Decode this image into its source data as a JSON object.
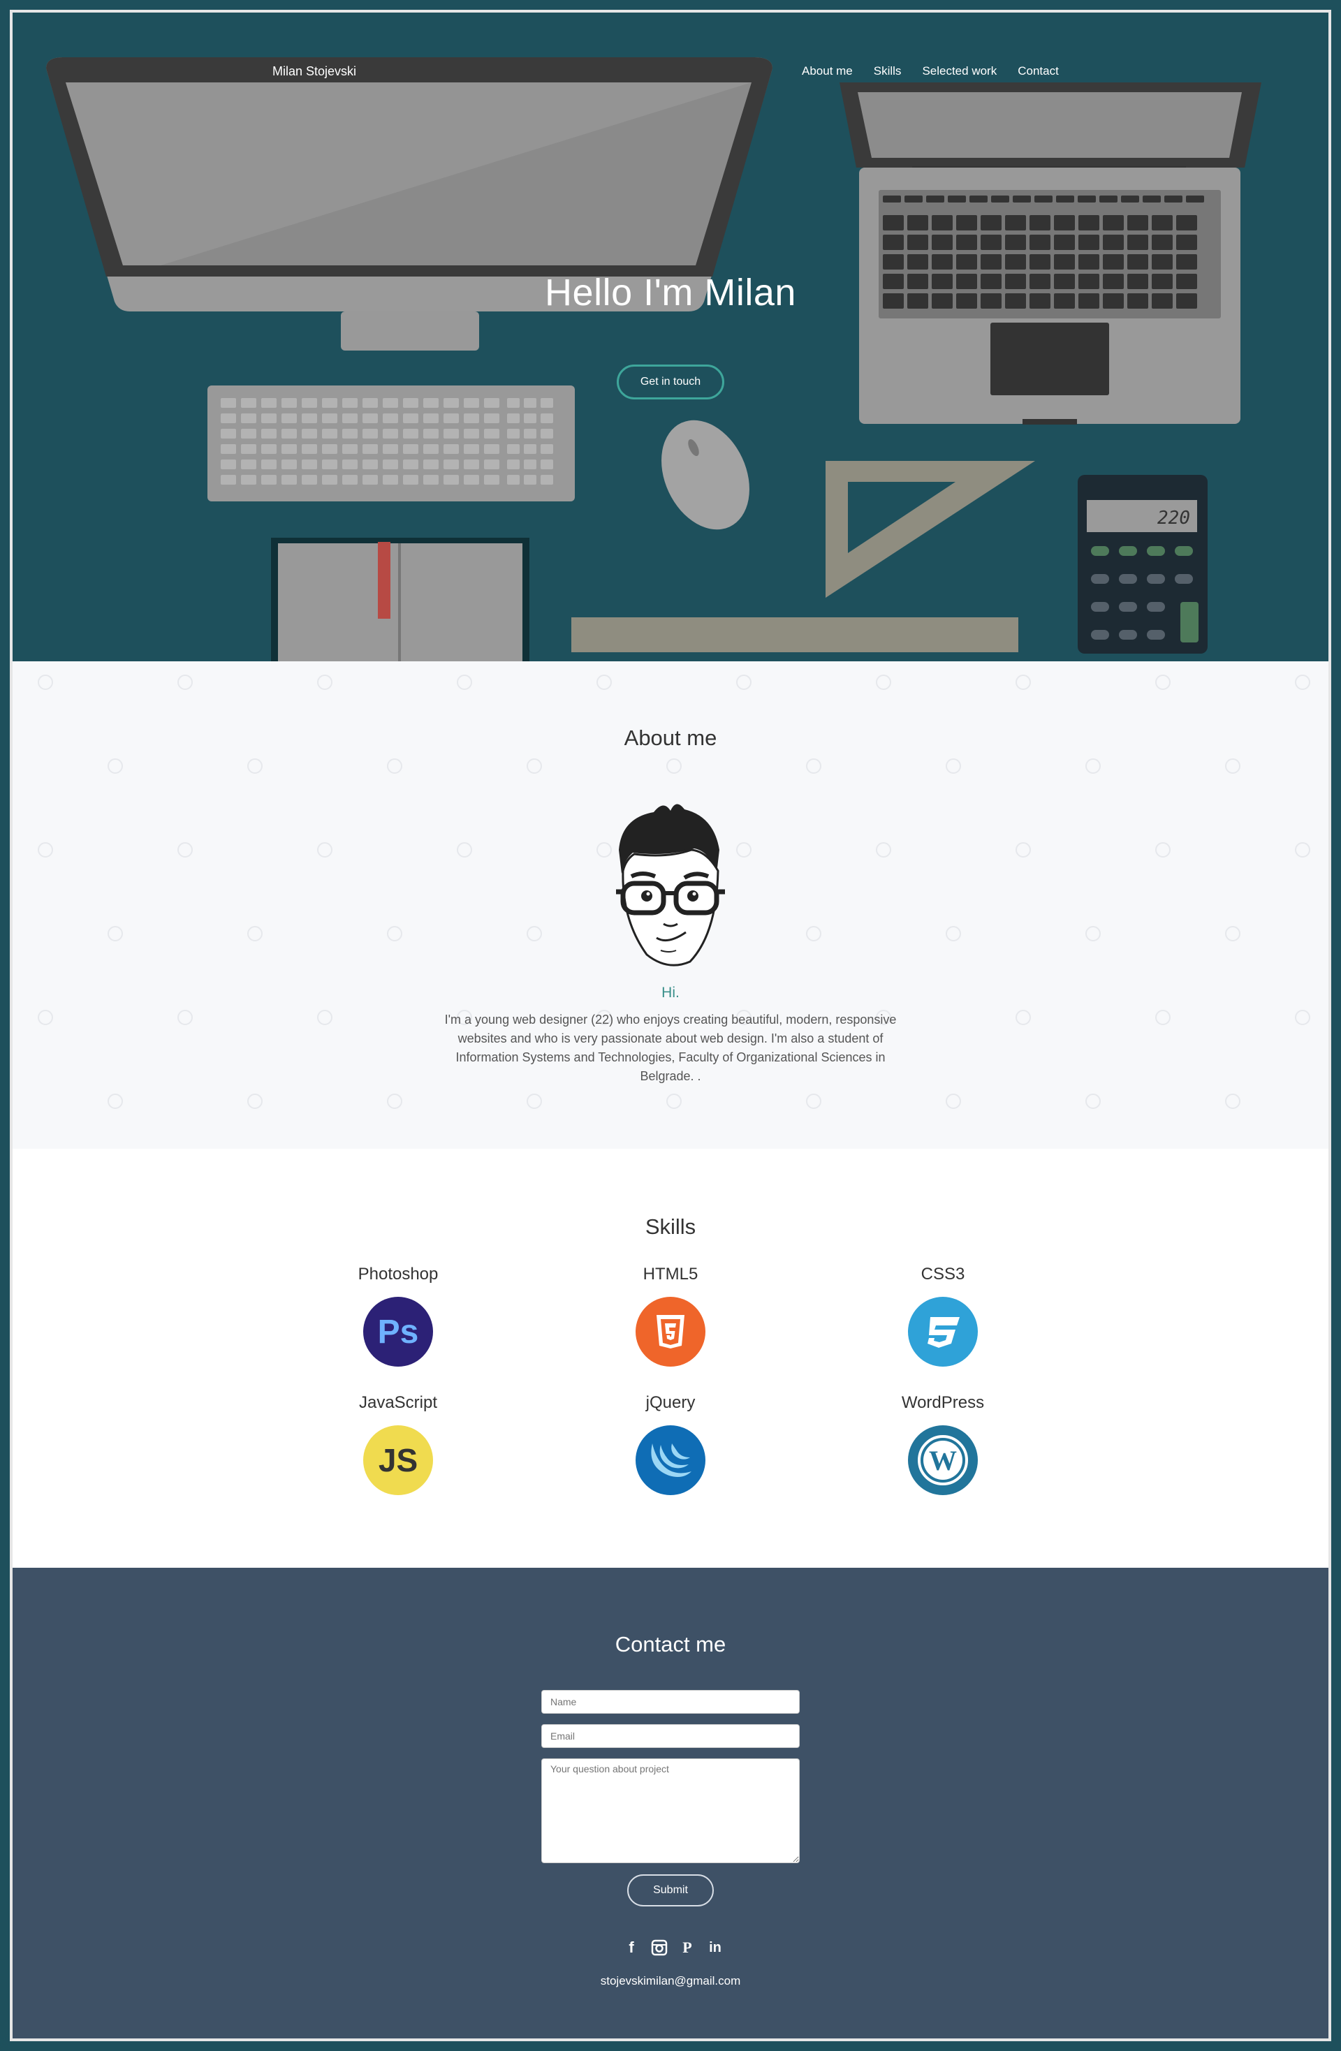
{
  "header": {
    "brand": "Milan Stojevski",
    "nav": [
      "About me",
      "Skills",
      "Selected work",
      "Contact"
    ]
  },
  "hero": {
    "title": "Hello I'm Milan",
    "cta": "Get in touch",
    "calculator_display": "220"
  },
  "about": {
    "title": "About me",
    "greeting": "Hi.",
    "bio": "I'm a young web designer (22) who enjoys creating beautiful, modern, responsive websites and who is very passionate about web design. I'm also a student of Information Systems and Technologies, Faculty of Organizational Sciences in Belgrade. ."
  },
  "skills": {
    "title": "Skills",
    "items": [
      {
        "label": "Photoshop",
        "icon": "photoshop-icon",
        "color": "#2c2176"
      },
      {
        "label": "HTML5",
        "icon": "html5-icon",
        "color": "#ef652a"
      },
      {
        "label": "CSS3",
        "icon": "css3-icon",
        "color": "#2fa2d8"
      },
      {
        "label": "JavaScript",
        "icon": "javascript-icon",
        "color": "#f0db4f"
      },
      {
        "label": "jQuery",
        "icon": "jquery-icon",
        "color": "#0f6db5"
      },
      {
        "label": "WordPress",
        "icon": "wordpress-icon",
        "color": "#21759b"
      }
    ]
  },
  "contact": {
    "title": "Contact me",
    "name_placeholder": "Name",
    "email_placeholder": "Email",
    "message_placeholder": "Your question about project",
    "submit": "Submit",
    "socials": [
      "facebook-icon",
      "instagram-icon",
      "pinterest-icon",
      "linkedin-icon"
    ],
    "email": "stojevskimilan@gmail.com"
  },
  "colors": {
    "hero_bg": "#1e505c",
    "accent": "#3ea69b",
    "contact_bg": "#3e5166"
  }
}
